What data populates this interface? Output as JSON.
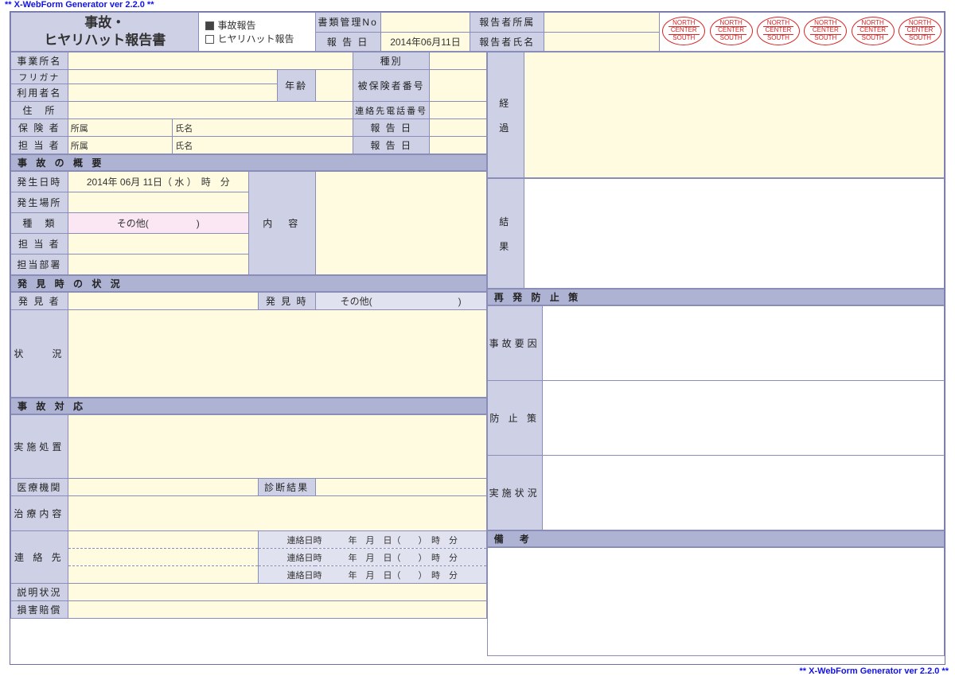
{
  "watermark": "** X-WebForm Generator ver 2.2.0 **",
  "title_l1": "事故・",
  "title_l2": "ヒヤリハット報告書",
  "cb1": "事故報告",
  "cb2": "ヒヤリハット報告",
  "docno": "書類管理No",
  "repdate": "報 告 日",
  "repdate_v": "2014年06月11日",
  "repaff": "報告者所属",
  "repname": "報告者氏名",
  "stamp_n": "NORTH",
  "stamp_c": "CENTER",
  "stamp_s": "SOUTH",
  "office": "事業所名",
  "kind": "種別",
  "furi": "フリガナ",
  "user": "利用者名",
  "age": "年齢",
  "insno": "被保険者番号",
  "addr": "住　所",
  "tel": "連絡先電話番号",
  "insurer": "保 険 者",
  "aff": "所属",
  "name": "氏名",
  "taff": "担 当 者",
  "rd": "報 告 日",
  "keika": "経",
  "keika2": "過",
  "sec_gai": "事 故 の 概 要",
  "occdt": "発生日時",
  "occdt_v": "2014年 06月 11日（ 水 ）　時　分",
  "occpl": "発生場所",
  "shurui": "種　類",
  "shurui_v": "その他(　　　　　)",
  "tantou": "担 当 者",
  "tantoubu": "担当部署",
  "naiyou": "内　容",
  "kekka1": "結",
  "kekka2": "果",
  "sec_hakken": "発 見 時 の 状 況",
  "hakkensha": "発 見 者",
  "hakkenji": "発 見 時",
  "hakken_v": "その他(　　　　　　　　　)",
  "joukyou": "状　　況",
  "sec_taio": "事 故 対 応",
  "jisshi": "実施処置",
  "iryou": "医療機関",
  "shindan": "診断結果",
  "chiryou": "治療内容",
  "renraku": "連 絡 先",
  "renraku_tmpl": "連絡日時　　　年　月　日（　　）　時　分",
  "setsumei": "説明状況",
  "songai": "損害賠償",
  "sec_saihatsu": "再 発 防 止 策",
  "youin": "事故要因",
  "boushi": "防 止 策",
  "jisshij": "実施状況",
  "biko": "備　考"
}
